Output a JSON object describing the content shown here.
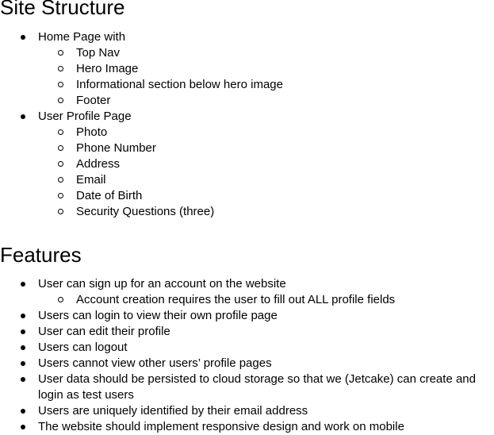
{
  "site_structure": {
    "heading": "Site Structure",
    "items": [
      {
        "label": "Home Page with",
        "children": [
          "Top Nav",
          "Hero Image",
          "Informational section below hero image",
          "Footer"
        ]
      },
      {
        "label": "User Profile Page",
        "children": [
          "Photo",
          "Phone Number",
          "Address",
          "Email",
          "Date of Birth",
          "Security Questions (three)"
        ]
      }
    ]
  },
  "features": {
    "heading": "Features",
    "items": [
      {
        "label": "User can sign up for an account on the website",
        "children": [
          "Account creation requires the user to fill out ALL profile fields"
        ]
      },
      {
        "label": "Users can login to view their own profile page",
        "children": []
      },
      {
        "label": "User can edit their profile",
        "children": []
      },
      {
        "label": "Users can logout",
        "children": []
      },
      {
        "label": "Users cannot view other users’ profile pages",
        "children": []
      },
      {
        "label": "User data should be persisted to cloud storage so that we (Jetcake) can create and login as test users",
        "children": []
      },
      {
        "label": "Users are uniquely identified by their email address",
        "children": []
      },
      {
        "label": "The website should implement responsive design and work on mobile",
        "children": []
      }
    ]
  }
}
